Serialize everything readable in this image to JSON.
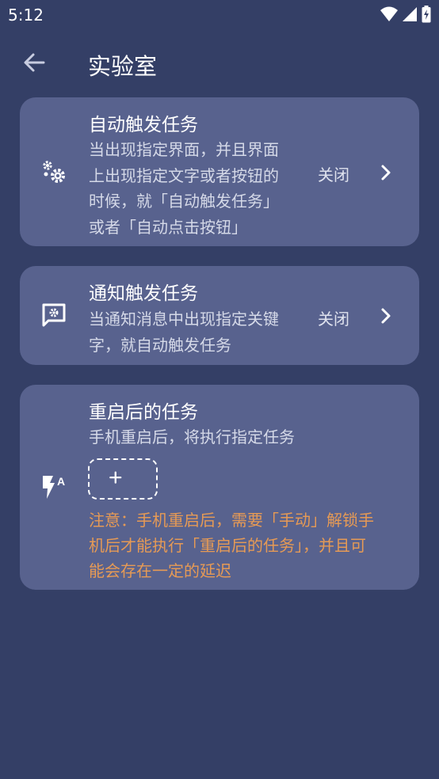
{
  "status_bar": {
    "time": "5:12"
  },
  "app_bar": {
    "title": "实验室"
  },
  "cards": [
    {
      "icon": "gears-icon",
      "title": "自动触发任务",
      "description_lines": [
        "当出现指定界面，并且界面",
        "上出现指定文字或者按钮的",
        "时候，就「自动触发任务」",
        "或者「自动点击按钮」"
      ],
      "state": "关闭"
    },
    {
      "icon": "message-gear-icon",
      "title": "通知触发任务",
      "description_lines": [
        "当通知消息中出现指定关键",
        "字，就自动触发任务"
      ],
      "state": "关闭"
    },
    {
      "icon": "flash-auto-icon",
      "title": "重启后的任务",
      "description_lines": [
        "手机重启后，将执行指定任务"
      ],
      "add_label": "+",
      "warning_lines": [
        "注意：手机重启后，需要「手动」解锁手",
        "机后才能执行「重启后的任务」，并且可",
        "能会存在一定的延迟"
      ]
    }
  ],
  "colors": {
    "background": "#343f66",
    "card": "#58628e",
    "warning": "#e69a55"
  }
}
